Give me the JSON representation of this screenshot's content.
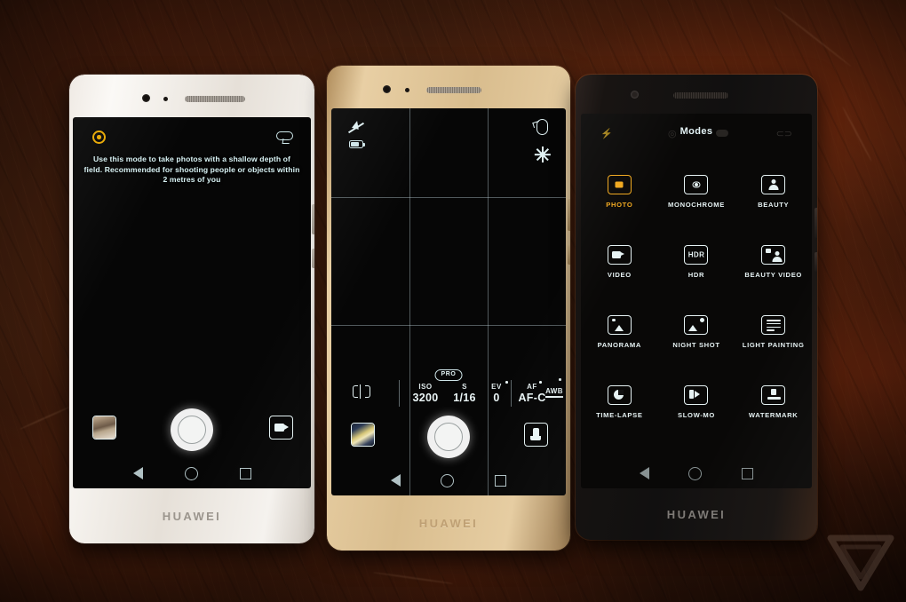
{
  "scene": {
    "description": "Three Huawei P9 smartphones lying on a dark reddish-brown wooden table, each showing a different camera app screen",
    "background_color": "#46200e",
    "watermark": "the-verge-logo"
  },
  "phones": [
    {
      "id": "phone-white",
      "color_name": "Ceramic White",
      "body_color": "#efeae4",
      "brand": "HUAWEI",
      "screen": {
        "mode": "wide-aperture",
        "hint_text": "Use this mode to take photos with a shallow depth of field. Recommended for shooting people or objects within 2 metres of you",
        "hint_color": "#d8f2f4",
        "top_left_icon": "aperture-icon",
        "top_left_icon_color": "#e8a800",
        "top_right_icon": "loop-shutter-icon",
        "bottom_left_icon": "gallery-thumbnail",
        "bottom_center_icon": "shutter-button",
        "bottom_right_icon": "video-camera-icon"
      },
      "nav": {
        "back": "back-triangle",
        "home": "home-circle",
        "recents": "recents-square"
      }
    },
    {
      "id": "phone-gold",
      "color_name": "Haze Gold",
      "body_color": "#d9bd8e",
      "brand": "HUAWEI",
      "screen": {
        "mode": "pro",
        "mode_badge": "PRO",
        "grid_overlay": "rule-of-thirds",
        "status_icons": [
          "flash-off-icon",
          "battery-icon",
          "timer-icon",
          "settings-gear-icon"
        ],
        "pro_controls": [
          {
            "key": "metering",
            "label": "",
            "value": "",
            "icon": "metering-icon"
          },
          {
            "key": "iso",
            "label": "ISO",
            "value": "3200"
          },
          {
            "key": "shutter",
            "label": "S",
            "value": "1/16"
          },
          {
            "key": "ev",
            "label": "EV",
            "value": "0"
          },
          {
            "key": "af",
            "label": "AF",
            "value": "AF-C"
          },
          {
            "key": "wb",
            "label": "AWB",
            "value": ""
          }
        ],
        "bottom_left_icon": "gallery-thumbnail",
        "bottom_center_icon": "shutter-button",
        "bottom_right_icon": "mode-switch-icon"
      },
      "nav": {
        "back": "back-triangle",
        "home": "home-circle",
        "recents": "recents-square"
      }
    },
    {
      "id": "phone-black",
      "color_name": "Titanium Grey",
      "body_color": "#1b1715",
      "brand": "HUAWEI",
      "screen": {
        "mode": "modes-picker",
        "title": "Modes",
        "selected_mode": "PHOTO",
        "selected_color": "#f0a81e",
        "modes": [
          {
            "label": "PHOTO",
            "icon": "photo-icon",
            "selected": true
          },
          {
            "label": "MONOCHROME",
            "icon": "monochrome-icon",
            "selected": false
          },
          {
            "label": "BEAUTY",
            "icon": "beauty-icon",
            "selected": false
          },
          {
            "label": "VIDEO",
            "icon": "video-icon",
            "selected": false
          },
          {
            "label": "HDR",
            "icon": "hdr-icon",
            "selected": false
          },
          {
            "label": "BEAUTY VIDEO",
            "icon": "beauty-video-icon",
            "selected": false
          },
          {
            "label": "PANORAMA",
            "icon": "panorama-icon",
            "selected": false
          },
          {
            "label": "NIGHT SHOT",
            "icon": "night-shot-icon",
            "selected": false
          },
          {
            "label": "LIGHT PAINTING",
            "icon": "light-painting-icon",
            "selected": false
          },
          {
            "label": "TIME-LAPSE",
            "icon": "time-lapse-icon",
            "selected": false
          },
          {
            "label": "SLOW-MO",
            "icon": "slow-mo-icon",
            "selected": false
          },
          {
            "label": "WATERMARK",
            "icon": "watermark-icon",
            "selected": false
          }
        ]
      },
      "nav": {
        "back": "back-triangle",
        "home": "home-circle",
        "recents": "recents-square"
      }
    }
  ]
}
